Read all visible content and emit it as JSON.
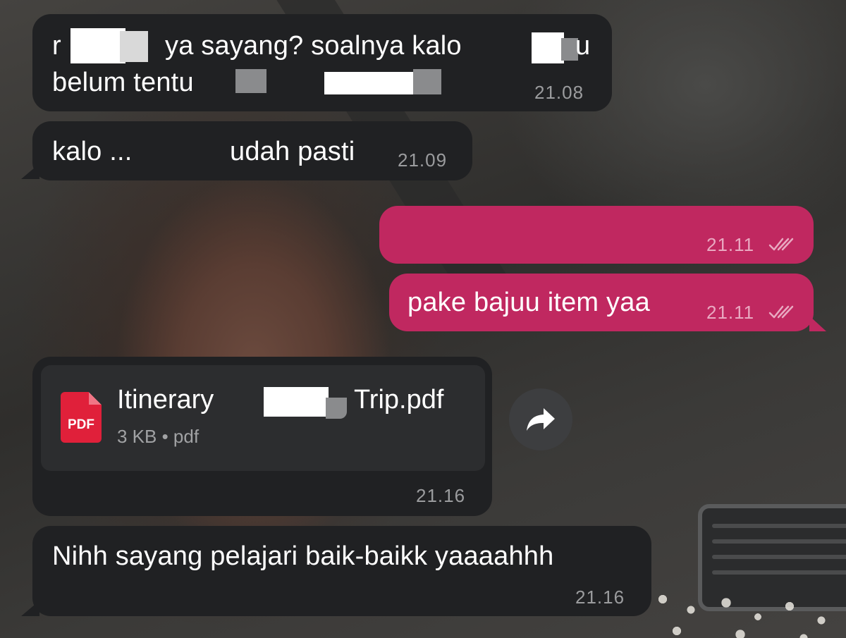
{
  "colors": {
    "incoming_bubble": "#202123",
    "outgoing_bubble": "#c02860",
    "timestamp_incoming": "#9b9c9e",
    "timestamp_outgoing": "#e9a9c1",
    "pdf_icon": "#e0203a"
  },
  "messages": [
    {
      "direction": "incoming",
      "line1_a": "r",
      "line1_b": "ya sayang? soalnya kalo",
      "line1_c": "u",
      "line2": "belum tentu",
      "time": "21.08"
    },
    {
      "direction": "incoming",
      "text_a": "kalo ...",
      "text_b": "udah pasti",
      "time": "21.09"
    },
    {
      "direction": "outgoing",
      "text": "",
      "time": "21.11",
      "status_icon": "double-check-icon"
    },
    {
      "direction": "outgoing",
      "text": "pake bajuu item yaa",
      "time": "21.11",
      "status_icon": "double-check-icon"
    },
    {
      "direction": "incoming",
      "type": "file",
      "file_icon_label": "PDF",
      "file_name_a": "Itinerary",
      "file_name_b": "Trip.pdf",
      "file_meta": "3 KB • pdf",
      "time": "21.16",
      "action_icon": "forward-arrow-icon"
    },
    {
      "direction": "incoming",
      "text": "Nihh sayang pelajari baik-baikk yaaaahhh",
      "time": "21.16"
    }
  ]
}
